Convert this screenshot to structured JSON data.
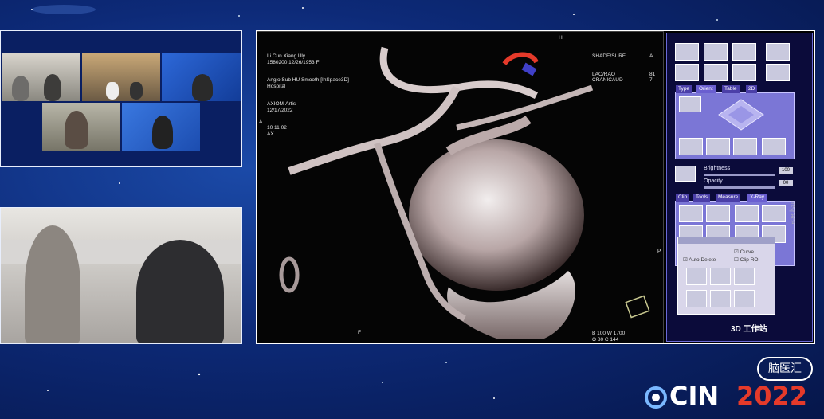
{
  "viewer": {
    "overlay_tl": [
      "Li Cun Xiang lilly",
      "1580200  12/26/1953  F",
      "Angio Sub HU Smooth [InSpace3D]",
      "Hospital",
      "AXIOM-Artis",
      "12/17/2022",
      "10 11 02",
      "AX"
    ],
    "overlay_tr_left": [
      "SHADE/SURF",
      "",
      "LAO/RAO",
      "CRANICAUD"
    ],
    "overlay_tr_right": [
      "",
      "A",
      "81",
      "7"
    ],
    "overlay_bottom": [
      "B  100   W  1700",
      "O   80   C   144"
    ],
    "orientation": {
      "top": "H",
      "left": "A",
      "bottom": "F",
      "right": "P"
    }
  },
  "toolpanel": {
    "tabs_top": [
      "Type",
      "Orient",
      "Table",
      "2D"
    ],
    "brightness_label": "Brightness",
    "brightness_value": "100",
    "opacity_label": "Opacity",
    "opacity_value": "00",
    "tabs_mid": [
      "Clip",
      "Tools",
      "Measure",
      "X-Ray"
    ],
    "dialog": {
      "curve": "Curve",
      "auto_delete": "Auto Delete",
      "clip_roi": "Clip ROI"
    },
    "footer": "3D 工作站",
    "side_label": "InSpace"
  },
  "brand": {
    "logo_text": "CIN",
    "logo_year": "2022",
    "watermark": "脑医汇"
  },
  "colors": {
    "background": "#0d2a78",
    "accent_red": "#e53a2a",
    "panel": "#7b76d6"
  }
}
